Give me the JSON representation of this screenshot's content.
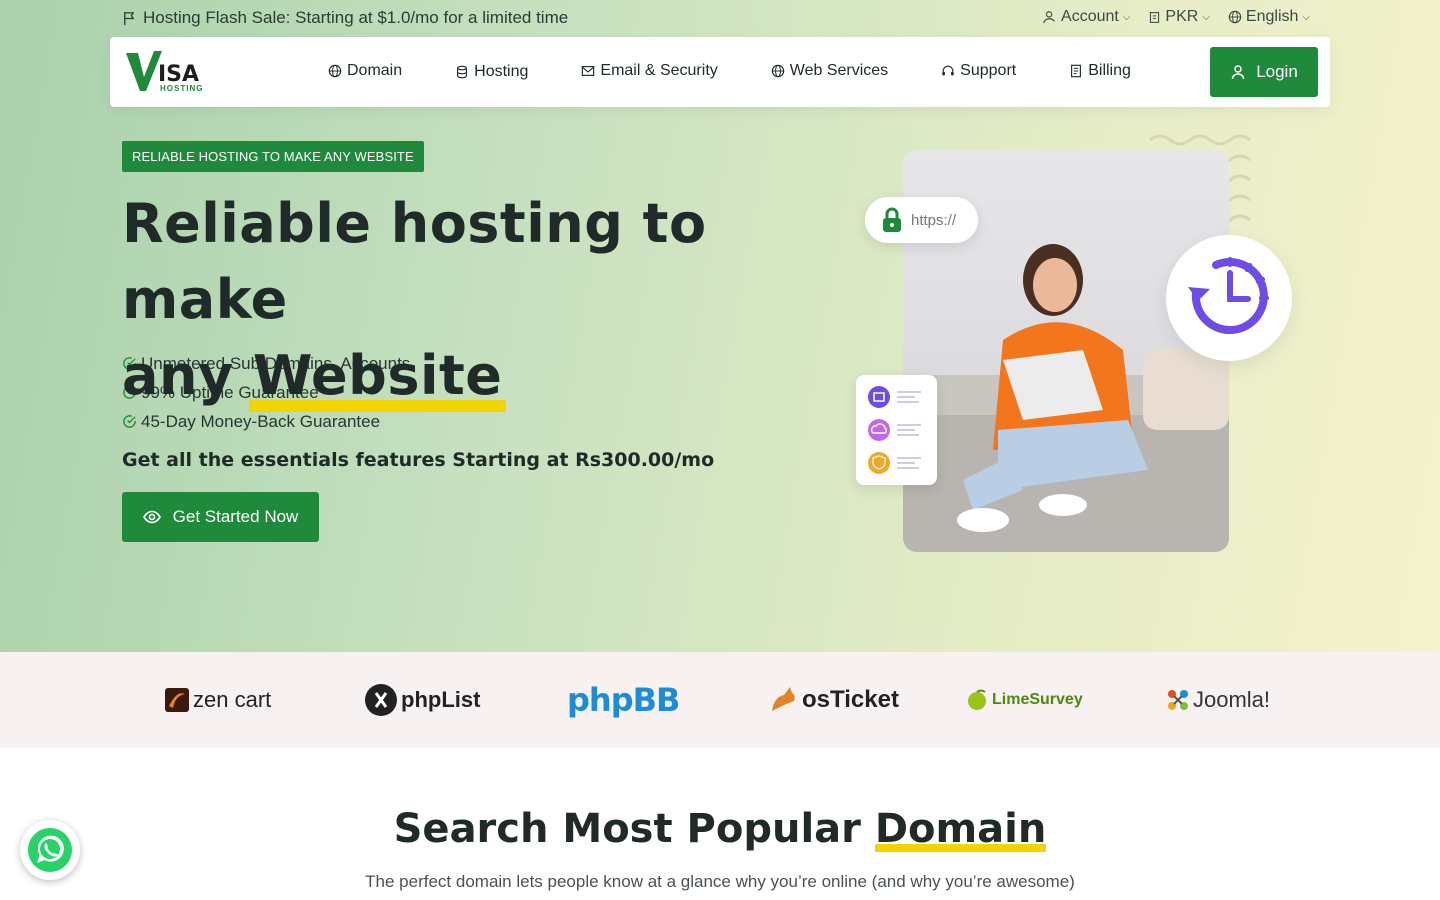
{
  "topbar": {
    "promo_text": "Hosting Flash Sale: Starting at $1.0/mo for a limited time",
    "account_label": "Account",
    "currency_label": "PKR",
    "language_label": "English"
  },
  "brand": {
    "logo_word": "ISA",
    "logo_sub": "HOSTING"
  },
  "nav": {
    "items": [
      {
        "label": "Domain",
        "icon": "globe-icon"
      },
      {
        "label": "Hosting",
        "icon": "database-icon"
      },
      {
        "label": "Email & Security",
        "icon": "mail-icon"
      },
      {
        "label": "Web Services",
        "icon": "globe-icon"
      },
      {
        "label": "Support",
        "icon": "headset-icon"
      },
      {
        "label": "Billing",
        "icon": "receipt-icon"
      }
    ],
    "login_label": "Login"
  },
  "hero": {
    "badge": "RELIABLE HOSTING TO MAKE ANY WEBSITE",
    "title_line1": "Reliable hosting to make",
    "title_any": "any",
    "title_highlight": "Website",
    "features": [
      "Unmetered Sub Domains, Accounts",
      "99% Uptime Guarantee",
      "45-Day Money-Back Guarantee"
    ],
    "essentials": "Get all the essentials features Starting at Rs300.00/mo",
    "cta_label": "Get Started Now",
    "https_chip": "https://"
  },
  "partners": [
    "zen cart",
    "phpList",
    "phpBB",
    "osTicket",
    "LimeSurvey",
    "Joomla!"
  ],
  "search_section": {
    "title_prefix": "Search Most Popular",
    "title_highlight": "Domain",
    "subtitle": "The perfect domain lets people know at a glance why you’re online (and why you’re awesome)"
  },
  "colors": {
    "primary": "#1f8a3b",
    "highlight": "#f2d400",
    "accent_purple": "#6e4ce6"
  }
}
